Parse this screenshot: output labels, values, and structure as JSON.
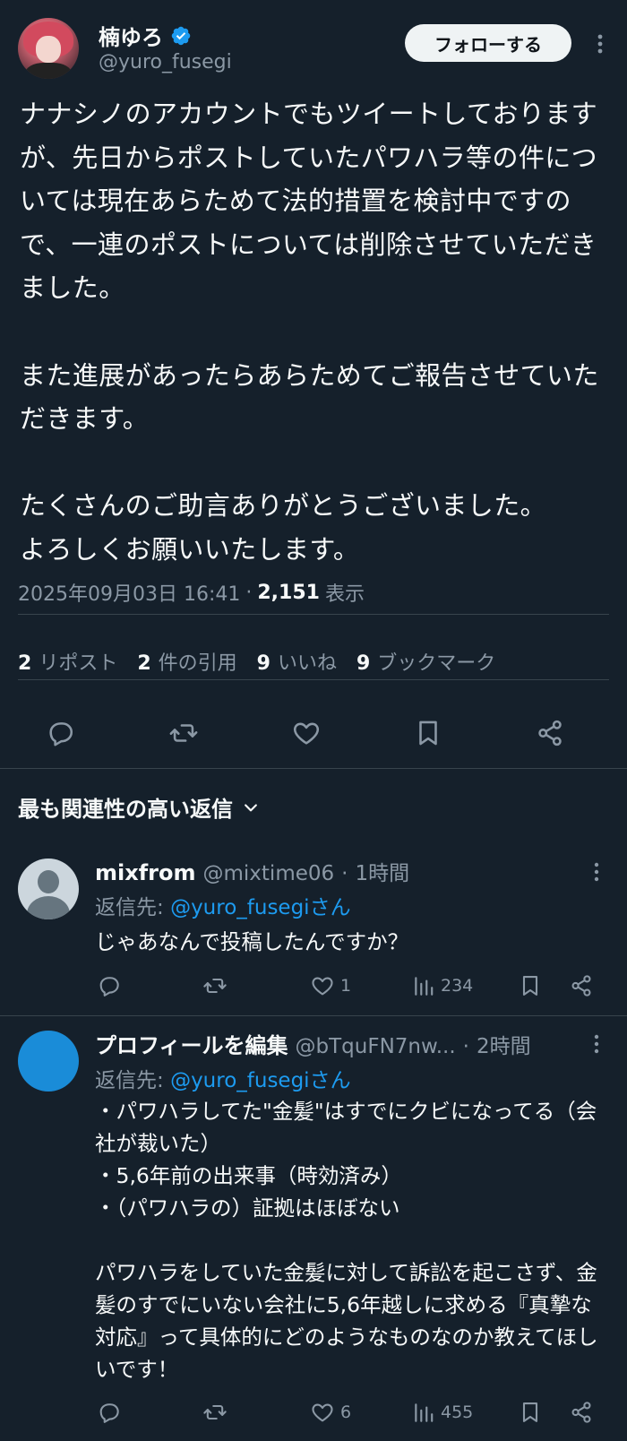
{
  "colors": {
    "background": "#15202b",
    "text": "#f7f9f9",
    "secondary": "#8b98a5",
    "accent": "#1d9bf0",
    "divider": "#38444d",
    "follow_bg": "#eff3f4"
  },
  "tweet": {
    "author": {
      "display_name": "楠ゆろ",
      "handle": "@yuro_fusegi",
      "verified": true
    },
    "follow_label": "フォローする",
    "body": "ナナシノのアカウントでもツイートしておりますが、先日からポストしていたパワハラ等の件については現在あらためて法的措置を検討中ですので、一連のポストについては削除させていただきました。\n\nまた進展があったらあらためてご報告させていただきます。\n\nたくさんのご助言ありがとうございました。\nよろしくお願いいたします。",
    "timestamp": "2025年09月03日 16:41",
    "separator": "·",
    "views_count": "2,151",
    "views_label": "表示",
    "stats": {
      "reposts_count": "2",
      "reposts_label": "リポスト",
      "quotes_count": "2",
      "quotes_label": "件の引用",
      "likes_count": "9",
      "likes_label": "いいね",
      "bookmarks_count": "9",
      "bookmarks_label": "ブックマーク"
    },
    "action_icons": [
      "reply-icon",
      "retweet-icon",
      "like-icon",
      "bookmark-icon",
      "share-icon"
    ]
  },
  "sort": {
    "label": "最も関連性の高い返信"
  },
  "replies": [
    {
      "display_name": "mixfrom",
      "handle": "@mixtime06",
      "separator": "·",
      "time": "1時間",
      "reply_to_label": "返信先: ",
      "reply_to_mention": "@yuro_fusegiさん",
      "text": "じゃあなんで投稿したんですか？",
      "likes": "1",
      "views": "234"
    },
    {
      "display_name": "プロフィールを編集",
      "handle": "@bTquFN7nw...",
      "separator": "·",
      "time": "2時間",
      "reply_to_label": "返信先: ",
      "reply_to_mention": "@yuro_fusegiさん",
      "text": "・パワハラしてた\"金髪\"はすでにクビになってる（会社が裁いた）\n・5,6年前の出来事（時効済み）\n・（パワハラの）証拠はほぼない\n\nパワハラをしていた金髪に対して訴訟を起こさず、金髪のすでにいない会社に5,6年越しに求める『真摯な対応』って具体的にどのようなものなのか教えてほしいです！",
      "likes": "6",
      "views": "455"
    }
  ]
}
